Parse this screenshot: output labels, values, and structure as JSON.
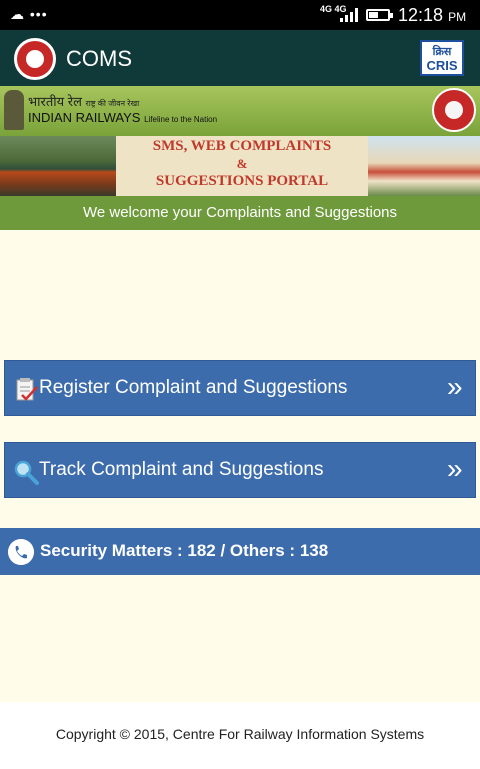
{
  "status_bar": {
    "left_icons": "☁ •••",
    "network": "4G 4G",
    "time": "12:18",
    "ampm": "PM"
  },
  "app_bar": {
    "title": "COMS",
    "logo_icon": "indian-railways-logo-icon",
    "cris_top": "क्रिस",
    "cris_bottom": "CRIS"
  },
  "header": {
    "hindi_title": "भारतीय रेल",
    "hindi_tagline": "राष्ट्र की जीवन रेखा",
    "english_title": "INDIAN RAILWAYS",
    "english_tagline": "Lifeline to the Nation"
  },
  "banner": {
    "line1": "SMS, WEB COMPLAINTS",
    "line2": "&",
    "line3": "SUGGESTIONS PORTAL"
  },
  "welcome_text": "We welcome your Complaints and Suggestions",
  "menu": {
    "register_label": "Register Complaint and Suggestions",
    "track_label": "Track Complaint and Suggestions",
    "chevron": "»"
  },
  "security": {
    "text": "Security Matters : 182 / Others : 138"
  },
  "footer": {
    "copyright": "Copyright © 2015, Centre For Railway Information Systems"
  },
  "colors": {
    "app_bar": "#103a3a",
    "button_blue": "#3d6cad",
    "welcome_green": "#6f9a3c",
    "page_bg": "#fffde9"
  }
}
